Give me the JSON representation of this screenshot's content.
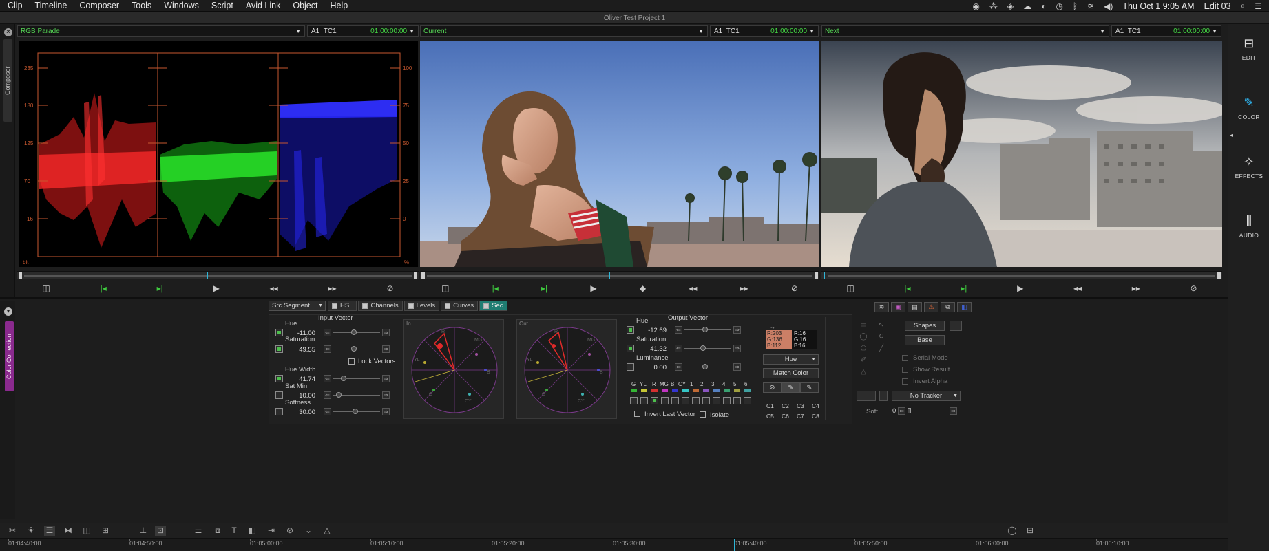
{
  "menubar": {
    "items": [
      "Clip",
      "Timeline",
      "Composer",
      "Tools",
      "Windows",
      "Script",
      "Avid Link",
      "Object",
      "Help"
    ],
    "datetime": "Thu Oct 1  9:05 AM",
    "sequence": "Edit 03"
  },
  "window_title": "Oliver Test Project 1",
  "left_tabs": {
    "composer": "Composer",
    "color_correction": "Color Correction"
  },
  "monitors": [
    {
      "name": "RGB Parade",
      "track": "A1",
      "tc_label": "TC1",
      "timecode": "01:00:00:00"
    },
    {
      "name": "Current",
      "track": "A1",
      "tc_label": "TC1",
      "timecode": "01:00:00:00"
    },
    {
      "name": "Next",
      "track": "A1",
      "tc_label": "TC1",
      "timecode": "01:00:00:00"
    }
  ],
  "parade": {
    "left_ticks": [
      "235",
      "180",
      "125",
      "70",
      "16"
    ],
    "right_ticks": [
      "100",
      "75",
      "50",
      "25",
      "0"
    ],
    "left_unit": "bit",
    "right_unit": "%"
  },
  "sidebar": [
    {
      "label": "EDIT",
      "icon": "edit-icon"
    },
    {
      "label": "COLOR",
      "icon": "eyedropper-icon"
    },
    {
      "label": "EFFECTS",
      "icon": "wand-icon"
    },
    {
      "label": "AUDIO",
      "icon": "waveform-icon"
    }
  ],
  "cc": {
    "src_segment": "Src Segment",
    "tabs": [
      "HSL",
      "Channels",
      "Levels",
      "Curves",
      "Sec"
    ],
    "input_vector_title": "Input Vector",
    "output_vector_title": "Output Vector",
    "input": {
      "hue_label": "Hue",
      "hue": "-11.00",
      "sat_label": "Saturation",
      "sat": "49.55",
      "lock_vectors": "Lock Vectors",
      "hue_width_label": "Hue Width",
      "hue_width": "41.74",
      "sat_min_label": "Sat Min",
      "sat_min": "10.00",
      "softness_label": "Softness",
      "softness": "30.00"
    },
    "vector_in_label": "In",
    "vector_out_label": "Out",
    "vector_letters": [
      "R",
      "MG",
      "B",
      "CY",
      "G",
      "YL"
    ],
    "output": {
      "hue_label": "Hue",
      "hue": "-12.69",
      "sat_label": "Saturation",
      "sat": "41.32",
      "lum_label": "Luminance",
      "lum": "0.00"
    },
    "presets_row": [
      "G",
      "YL",
      "R",
      "MG",
      "B",
      "CY",
      "1",
      "2",
      "3",
      "4",
      "5",
      "6"
    ],
    "invert_last_vector": "Invert Last Vector",
    "isolate": "Isolate",
    "match": {
      "left": [
        "R:203",
        "G:136",
        "B:112"
      ],
      "right": [
        "R:16",
        "G:16",
        "B:16"
      ],
      "hue_dropdown": "Hue",
      "match_color": "Match Color",
      "c_buttons": [
        "C1",
        "C2",
        "C3",
        "C4",
        "C5",
        "C6",
        "C7",
        "C8"
      ]
    },
    "shapes": {
      "shapes": "Shapes",
      "base": "Base",
      "serial_mode": "Serial Mode",
      "show_result": "Show Result",
      "invert_alpha": "Invert Alpha",
      "tracker": "No Tracker",
      "soft_label": "Soft",
      "soft_value": "0"
    },
    "colors": {
      "accent": "#1f7d72",
      "tc_green": "#44d944",
      "cc_purple": "#8a2a8e"
    }
  },
  "timeline": {
    "ticks": [
      "01:04:40:00",
      "01:04:50:00",
      "01:05:00:00",
      "01:05:10:00",
      "01:05:20:00",
      "01:05:30:00",
      "01:05:40:00",
      "01:05:50:00",
      "01:06:00:00",
      "01:06:10:00"
    ]
  }
}
